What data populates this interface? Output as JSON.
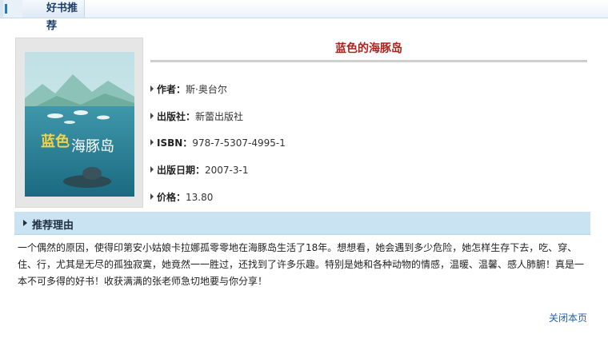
{
  "header": {
    "tab_label": "好书推荐"
  },
  "book": {
    "title": "蓝色的海豚岛",
    "cover_alt": "蓝色的海豚岛 book cover",
    "info": [
      {
        "label": "作者：",
        "value": "斯·奥台尔"
      },
      {
        "label": "出版社：",
        "value": "新蕾出版社"
      },
      {
        "label": "ISBN：",
        "value": "978-7-5307-4995-1"
      },
      {
        "label": "出版日期：",
        "value": "2007-3-1"
      },
      {
        "label": "价格：",
        "value": "13.80"
      }
    ]
  },
  "reason": {
    "heading": "推荐理由",
    "text": "一个偶然的原因，使得印第安小姑娘卡拉娜孤零零地在海豚岛生活了18年。想想看，她会遇到多少危险，她怎样生存下去，吃、穿、住、行，尤其是无尽的孤独寂寞，她竟然一一胜过，还找到了许多乐趣。特别是她和各种动物的情感，温暖、温馨、感人肺腑！真是一本不可多得的好书！收获满满的张老师急切地要与你分享！"
  },
  "footer": {
    "close_label": "关闭本页"
  },
  "colors": {
    "title": "#b0211b",
    "reason_bar": "#c9e3f3",
    "link": "#2060a8"
  },
  "icons": [
    "triangle-right-icon"
  ]
}
